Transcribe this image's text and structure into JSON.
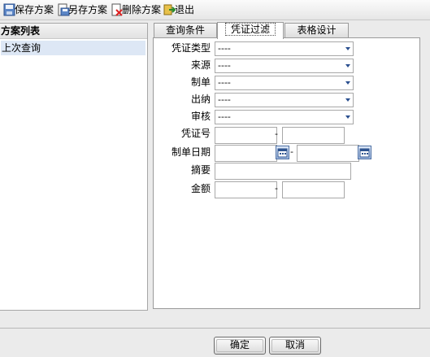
{
  "toolbar": {
    "save": "保存方案",
    "save_as": "另存方案",
    "delete": "删除方案",
    "exit": "退出"
  },
  "left_panel": {
    "header": "方案列表",
    "items": [
      "上次查询"
    ]
  },
  "tabs": [
    "查询条件",
    "凭证过滤",
    "表格设计"
  ],
  "active_tab": "凭证过滤",
  "form": {
    "voucher_type": {
      "label": "凭证类型",
      "value": "----"
    },
    "source": {
      "label": "来源",
      "value": "----"
    },
    "maker": {
      "label": "制单",
      "value": "----"
    },
    "cashier": {
      "label": "出纳",
      "value": "----"
    },
    "auditor": {
      "label": "审核",
      "value": "----"
    },
    "voucher_no": {
      "label": "凭证号",
      "from": "",
      "to": "",
      "sep": "-"
    },
    "make_date": {
      "label": "制单日期",
      "from": "",
      "to": "",
      "sep": "-"
    },
    "summary": {
      "label": "摘要",
      "value": ""
    },
    "amount": {
      "label": "金额",
      "from": "",
      "to": "",
      "sep": "-"
    }
  },
  "buttons": {
    "ok": "确定",
    "cancel": "取消"
  },
  "icons": {
    "save": "save-icon",
    "save_as": "save-as-icon",
    "delete": "delete-icon",
    "exit": "exit-icon",
    "calendar": "calendar-icon"
  },
  "colors": {
    "selected_row": "#dde7f5",
    "calendar_icon": "#4d6fa3"
  }
}
